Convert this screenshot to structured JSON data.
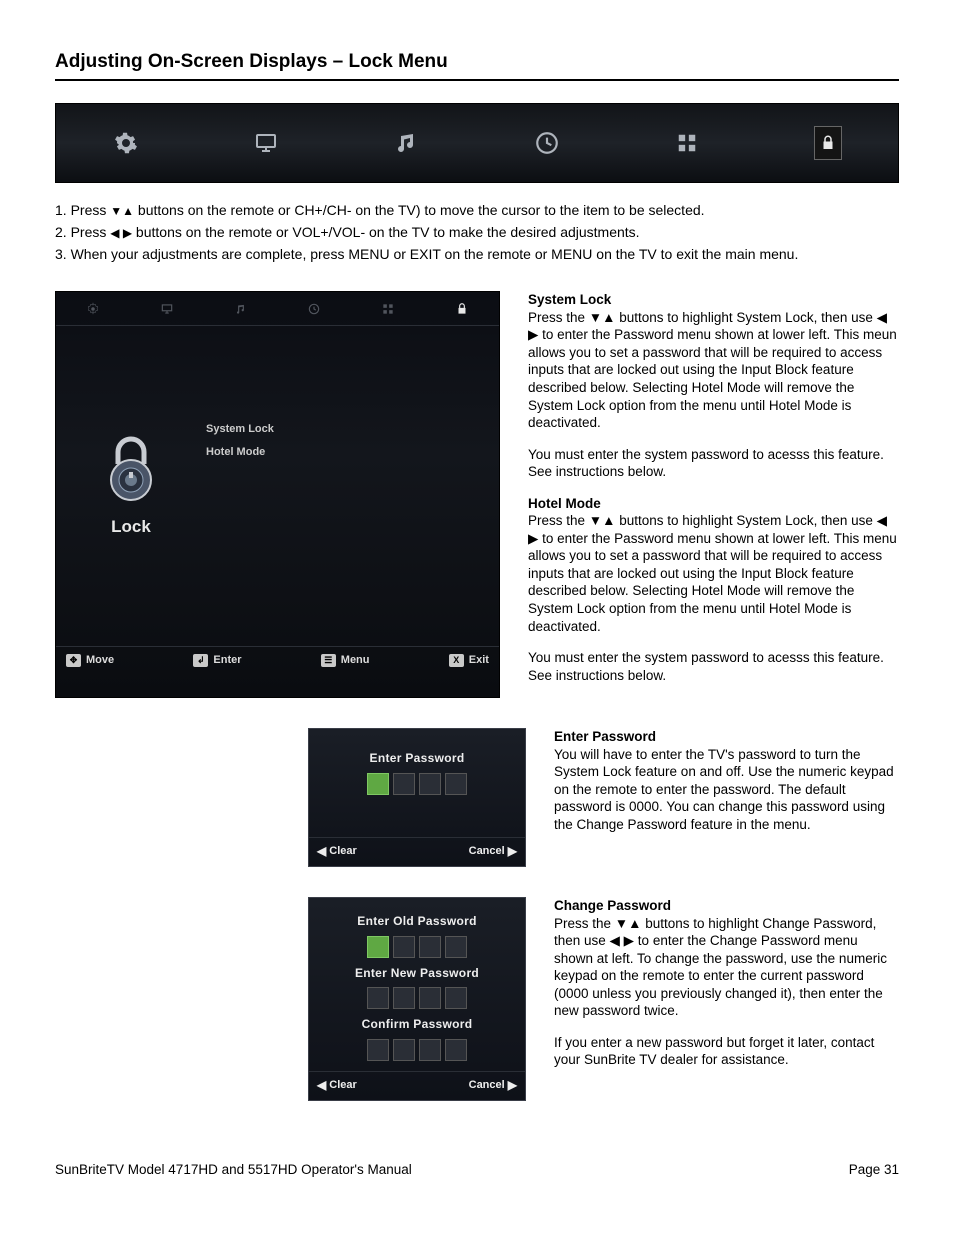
{
  "page_title": "Adjusting On-Screen Displays – Lock Menu",
  "instructions": {
    "line1_before": "1. Press ",
    "line1_after": " buttons on the remote or CH+/CH- on the TV) to move the cursor to the item to be selected.",
    "line2_before": "2. Press ",
    "line2_after": " buttons on the remote or VOL+/VOL- on the TV to make the desired adjustments.",
    "line3": "3. When your adjustments are complete, press MENU or EXIT on the remote or MENU on the TV to exit the main menu."
  },
  "lock_menu": {
    "title": "Lock",
    "items": {
      "system_lock": "System Lock",
      "hotel_mode": "Hotel Mode"
    },
    "footer": {
      "move": "Move",
      "enter": "Enter",
      "menu": "Menu",
      "exit": "Exit"
    }
  },
  "descriptions": {
    "system_lock_title": "System Lock",
    "system_lock_body": "Press the ▼▲ buttons to highlight System Lock, then use ◀ ▶ to enter the Password menu shown at lower left. This meun allows you to set a password that will be required to access inputs that are locked out using the Input Block feature described below. Selecting Hotel Mode will remove the System Lock option from the menu until Hotel Mode is deactivated.",
    "system_lock_note": "You must enter the  system password to acesss this feature. See instructions below.",
    "hotel_mode_title": "Hotel Mode",
    "hotel_mode_body": "Press the ▼▲ buttons to highlight System Lock, then use ◀ ▶ to enter the Password menu shown at lower left. This menu allows you to set a password that will be required to access inputs that are locked out using the Input Block feature described below. Selecting Hotel Mode will remove the System Lock option from the menu until Hotel Mode is deactivated.",
    "hotel_mode_note": "You must enter the  system password to acesss this feature. See instructions below.",
    "enter_pw_title": "Enter Password",
    "enter_pw_body": "You will have to enter the TV's password to turn the System Lock feature on and off. Use the numeric keypad on the remote to enter the password. The default password is 0000. You can change this password using the Change Password feature in the menu.",
    "change_pw_title": "Change Password",
    "change_pw_body": "Press the ▼▲ buttons to highlight Change Password, then use ◀ ▶ to enter the Change Password menu shown at left.  To change the password, use the numeric keypad on the remote to enter the current password (0000 unless you previously changed it), then enter the new password twice.",
    "change_pw_note": "If you enter a new password but forget it later, contact your SunBrite TV dealer for assistance."
  },
  "pw_dialog1": {
    "title": "Enter Password",
    "clear": "Clear",
    "cancel": "Cancel"
  },
  "pw_dialog2": {
    "old": "Enter Old Password",
    "new": "Enter New Password",
    "confirm": "Confirm Password",
    "clear": "Clear",
    "cancel": "Cancel"
  },
  "footer": {
    "model": "SunBriteTV Model 4717HD and 5517HD Operator's Manual",
    "page": "Page 31"
  }
}
